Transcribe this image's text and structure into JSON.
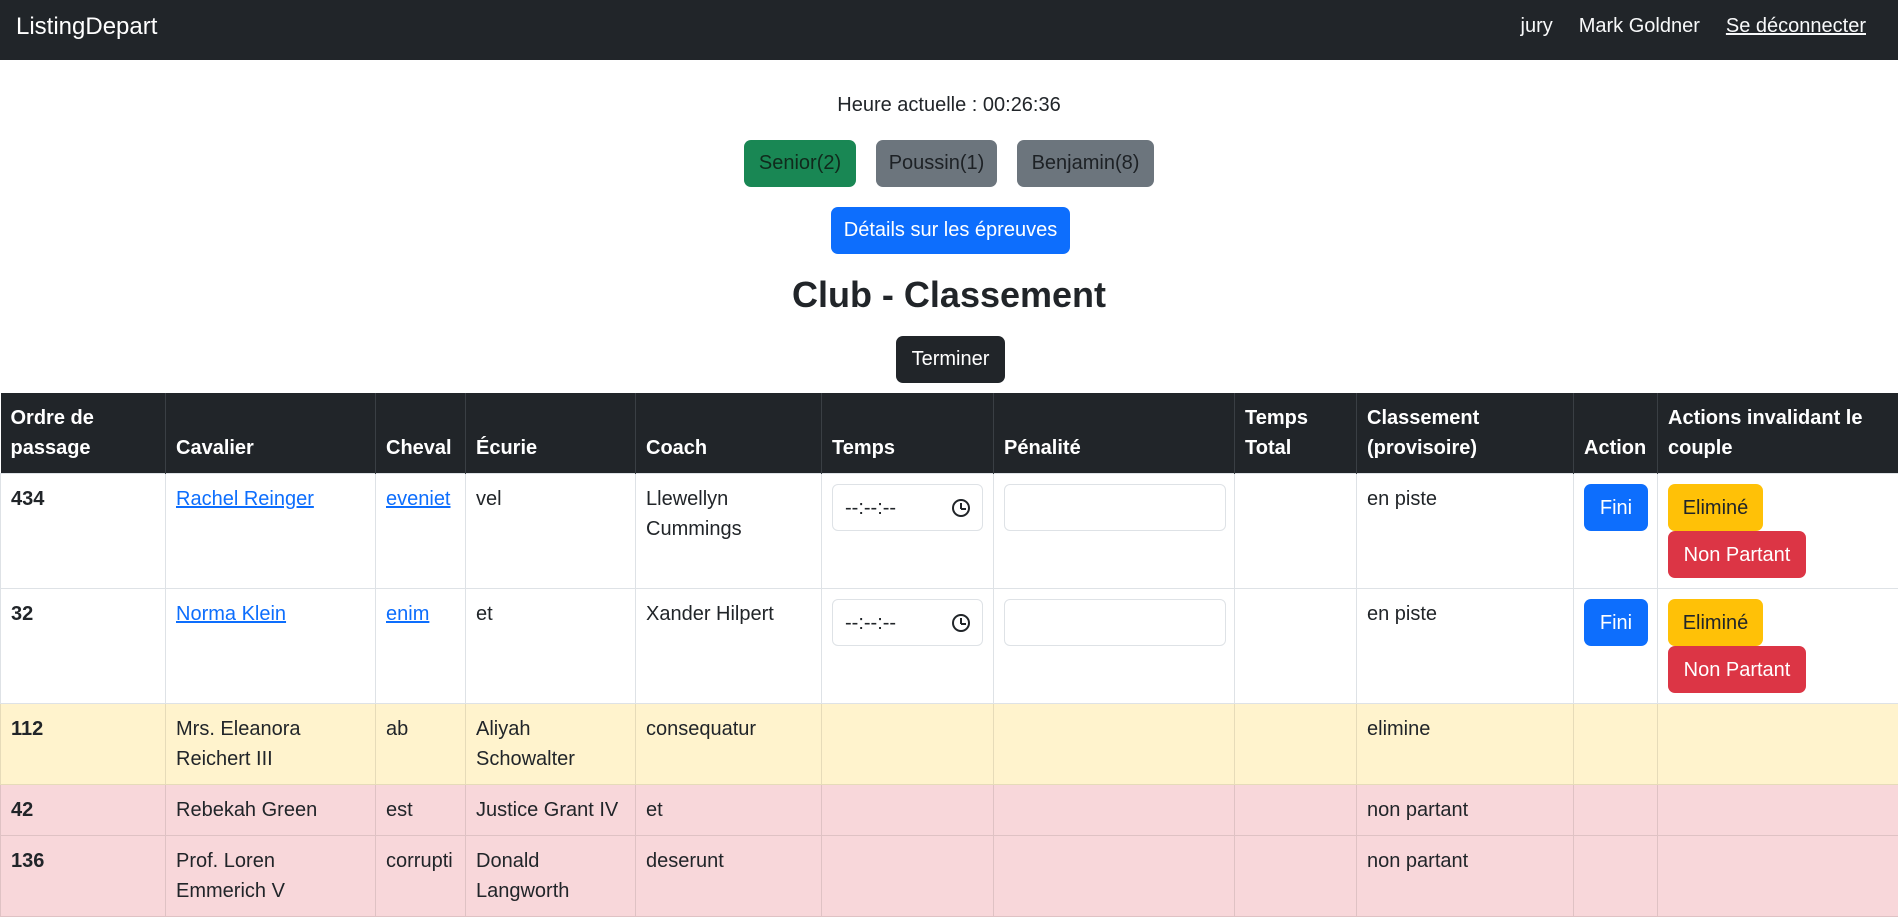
{
  "navbar": {
    "brand": "ListingDepart",
    "role": "jury",
    "user": "Mark Goldner",
    "logout": "Se déconnecter"
  },
  "time": {
    "text": "Heure actuelle : 00:26:36"
  },
  "categories": [
    {
      "label": "Senior(2)",
      "active": true
    },
    {
      "label": "Poussin(1)",
      "active": false
    },
    {
      "label": "Benjamin(8)",
      "active": false
    }
  ],
  "details_button": "Détails sur les épreuves",
  "title": "Club - Classement",
  "terminer_button": "Terminer",
  "table": {
    "headers": [
      "Ordre de passage",
      "Cavalier",
      "Cheval",
      "Écurie",
      "Coach",
      "Temps",
      "Pénalité",
      "Temps Total",
      "Classement (provisoire)",
      "Action",
      "Actions invalidant le couple"
    ],
    "time_placeholder": "--:--:--",
    "fini_label": "Fini",
    "elimine_label": "Eliminé",
    "non_partant_label": "Non Partant",
    "rows": [
      {
        "ordre": "434",
        "cavalier": "Rachel Reinger",
        "cheval": "eveniet",
        "ecurie": "vel",
        "coach": "Llewellyn Cummings",
        "classement": "en piste"
      },
      {
        "ordre": "32",
        "cavalier": "Norma Klein",
        "cheval": "enim",
        "ecurie": "et",
        "coach": "Xander Hilpert",
        "classement": "en piste"
      },
      {
        "ordre": "112",
        "cavalier": "Mrs. Eleanora Reichert III",
        "cheval": "ab",
        "ecurie": "Aliyah Schowalter",
        "coach": "consequatur",
        "classement": "elimine"
      },
      {
        "ordre": "42",
        "cavalier": "Rebekah Green",
        "cheval": "est",
        "ecurie": "Justice Grant IV",
        "coach": "et",
        "classement": "non partant"
      },
      {
        "ordre": "136",
        "cavalier": "Prof. Loren Emmerich V",
        "cheval": "corrupti",
        "ecurie": "Donald Langworth",
        "coach": "deserunt",
        "classement": "non partant"
      }
    ]
  },
  "colors": {
    "navbar_bg": "#212529",
    "primary": "#0d6efd",
    "success": "#198754",
    "secondary": "#6c757d",
    "warning": "#ffc107",
    "danger": "#dc3545",
    "row_warning_bg": "#fff3cd",
    "row_danger_bg": "#f8d7da"
  }
}
